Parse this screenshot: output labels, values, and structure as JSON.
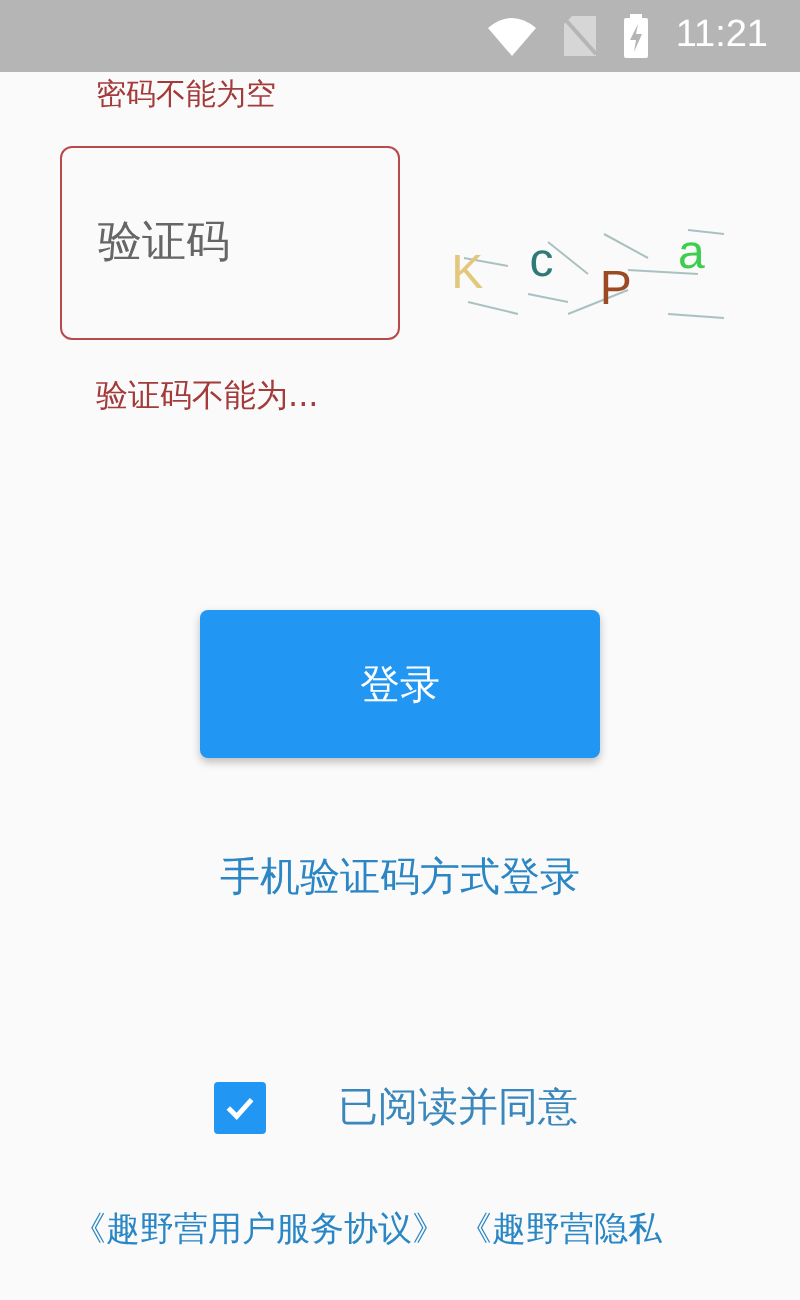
{
  "status_bar": {
    "time": "11:21"
  },
  "password_error": "密码不能为空",
  "captcha_field": {
    "placeholder": "验证码"
  },
  "captcha_image": {
    "characters": [
      {
        "char": "K",
        "color": "#e3c77a"
      },
      {
        "char": "c",
        "color": "#2f7a78"
      },
      {
        "char": "P",
        "color": "#9c4a22"
      },
      {
        "char": "a",
        "color": "#3ccf4e"
      }
    ]
  },
  "captcha_error": "验证码不能为...",
  "login_button": "登录",
  "sms_login_link": "手机验证码方式登录",
  "agreement": {
    "checked": true,
    "label": "已阅读并同意"
  },
  "policy_links": [
    "《趣野营用户服务协议》",
    "《趣野营隐私"
  ]
}
